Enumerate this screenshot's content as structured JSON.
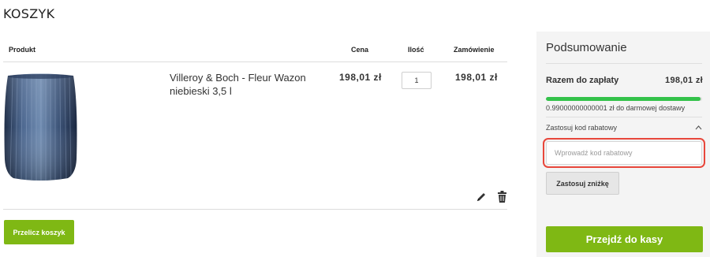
{
  "page": {
    "title": "KOSZYK"
  },
  "cart": {
    "headers": {
      "product": "Produkt",
      "price": "Cena",
      "quantity": "Ilość",
      "order": "Zamówienie"
    },
    "items": [
      {
        "name": "Villeroy & Boch - Fleur Wazon niebieski 3,5 l",
        "price": "198,01 zł",
        "quantity": "1",
        "order_total": "198,01 zł",
        "image": "blue-ribbed-vase",
        "icons": {
          "edit": "pencil-icon",
          "delete": "trash-icon"
        }
      }
    ],
    "recalculate_label": "Przelicz koszyk",
    "accent_color": "#7fb814"
  },
  "summary": {
    "title": "Podsumowanie",
    "total_label": "Razem do zapłaty",
    "total_value": "198,01 zł",
    "free_shipping_progress": 0.99,
    "progress_color": "#33c24a",
    "free_shipping_text": "0.99000000000001 zł do darmowej dostawy",
    "discount": {
      "toggle_label": "Zastosuj kod rabatowy",
      "toggle_icon": "chevron-up-icon",
      "placeholder": "Wprowadź kod rabatowy",
      "value": "",
      "apply_label": "Zastosuj zniżkę",
      "focus_color": "#e8473b"
    },
    "checkout_label": "Przejdź do kasy"
  }
}
